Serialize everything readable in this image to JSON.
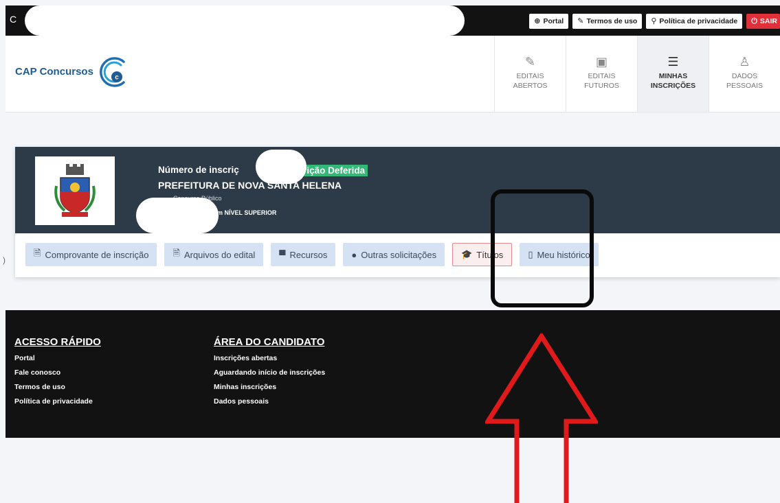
{
  "topbar": {
    "left_char": "C",
    "links": [
      {
        "icon": "globe-icon",
        "glyph": "⊕",
        "label": "Portal"
      },
      {
        "icon": "document-pen-icon",
        "glyph": "✎",
        "label": "Termos de uso"
      },
      {
        "icon": "user-lock-icon",
        "glyph": "⚲",
        "label": "Política de privacidade"
      }
    ],
    "logout": {
      "icon": "power-icon",
      "glyph": "⏻",
      "label": "SAIR"
    }
  },
  "header": {
    "brand": "CAP Concursos",
    "logo_letter": "c",
    "nav": [
      {
        "icon": "edit-square-icon",
        "glyph": "✎",
        "label": "EDITAIS\nABERTOS",
        "active": false
      },
      {
        "icon": "calendar-icon",
        "glyph": "▣",
        "label": "EDITAIS\nFUTUROS",
        "active": false
      },
      {
        "icon": "list-icon",
        "glyph": "☰",
        "label": "MINHAS\nINSCRIÇÕES",
        "active": true
      },
      {
        "icon": "user-icon",
        "glyph": "♙",
        "label": "DADOS\nPESSOAIS",
        "active": false
      }
    ]
  },
  "card": {
    "inscricao_label": "Número de inscriç",
    "status": "nscrição Deferida",
    "org": "PREFEITURA DE NOVA SANTA HELENA",
    "sub1": "Concurso Público",
    "sub2": "dico em NÍVEL SUPERIOR",
    "buttons": [
      {
        "icon": "file-icon",
        "glyph": "🗎",
        "label": "Comprovante de inscrição"
      },
      {
        "icon": "file-icon",
        "glyph": "🗎",
        "label": "Arquivos do edital"
      },
      {
        "icon": "message-icon",
        "glyph": "▀",
        "label": "Recursos"
      },
      {
        "icon": "comments-icon",
        "glyph": "●",
        "label": "Outras solicitações"
      },
      {
        "icon": "graduation-cap-icon",
        "glyph": "🎓",
        "label": "Títulos"
      },
      {
        "icon": "clipboard-icon",
        "glyph": "▯",
        "label": "Meu histórico"
      }
    ]
  },
  "footer": {
    "col1": {
      "title": "ACESSO RÁPIDO",
      "items": [
        "Portal",
        "Fale conosco",
        "Termos de uso",
        "Política de privacidade"
      ]
    },
    "col2": {
      "title": "ÁREA DO CANDIDATO",
      "items": [
        "Inscrições abertas",
        "Aguardando início de inscrições",
        "Minhas inscrições",
        "Dados pessoais"
      ]
    }
  },
  "colors": {
    "accent_red": "#e0303a",
    "status_green": "#33b877",
    "card_header": "#2d3a47",
    "brand_blue": "#1f5c94"
  }
}
